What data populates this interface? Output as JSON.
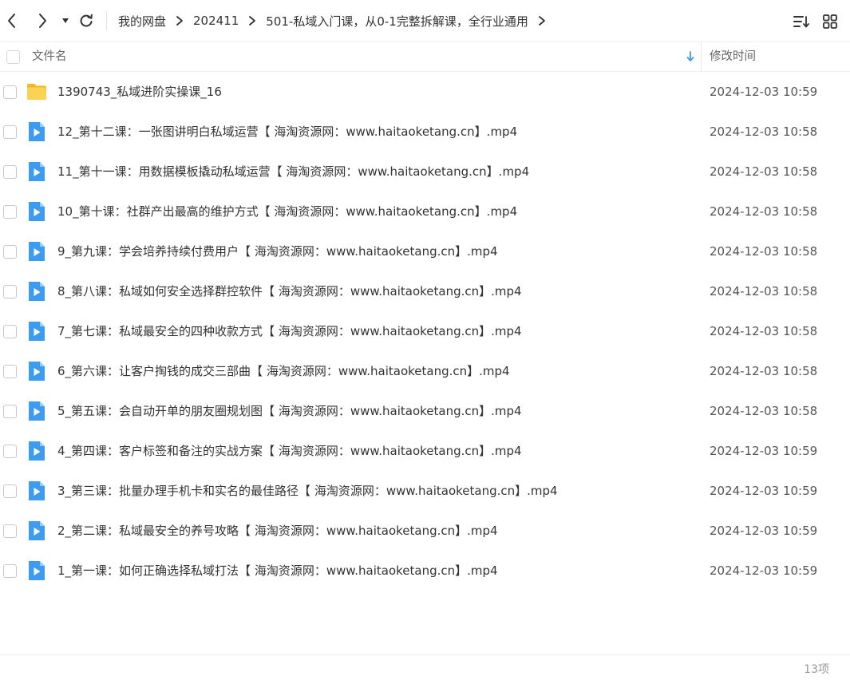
{
  "breadcrumb": [
    "我的网盘",
    "202411",
    "501-私域入门课，从0-1完整拆解课，全行业通用"
  ],
  "header": {
    "col_name": "文件名",
    "col_time": "修改时间"
  },
  "colors": {
    "folder": "#F7C843",
    "video": "#3D9BF0",
    "text": "#333333",
    "muted": "#999999"
  },
  "files": [
    {
      "name": "1390743_私域进阶实操课_16",
      "time": "2024-12-03 10:59",
      "type": "folder"
    },
    {
      "name": "12_第十二课：一张图讲明白私域运营【 海淘资源网：www.haitaoketang.cn】.mp4",
      "time": "2024-12-03 10:58",
      "type": "video"
    },
    {
      "name": "11_第十一课：用数据模板撬动私域运营【 海淘资源网：www.haitaoketang.cn】.mp4",
      "time": "2024-12-03 10:58",
      "type": "video"
    },
    {
      "name": "10_第十课：社群产出最高的维护方式【 海淘资源网：www.haitaoketang.cn】.mp4",
      "time": "2024-12-03 10:58",
      "type": "video"
    },
    {
      "name": "9_第九课：学会培养持续付费用户【 海淘资源网：www.haitaoketang.cn】.mp4",
      "time": "2024-12-03 10:58",
      "type": "video"
    },
    {
      "name": "8_第八课：私域如何安全选择群控软件【 海淘资源网：www.haitaoketang.cn】.mp4",
      "time": "2024-12-03 10:58",
      "type": "video"
    },
    {
      "name": "7_第七课：私域最安全的四种收款方式【 海淘资源网：www.haitaoketang.cn】.mp4",
      "time": "2024-12-03 10:58",
      "type": "video"
    },
    {
      "name": "6_第六课：让客户掏钱的成交三部曲【 海淘资源网：www.haitaoketang.cn】.mp4",
      "time": "2024-12-03 10:58",
      "type": "video"
    },
    {
      "name": "5_第五课：会自动开单的朋友圈规划图【 海淘资源网：www.haitaoketang.cn】.mp4",
      "time": "2024-12-03 10:58",
      "type": "video"
    },
    {
      "name": "4_第四课：客户标签和备注的实战方案【 海淘资源网：www.haitaoketang.cn】.mp4",
      "time": "2024-12-03 10:59",
      "type": "video"
    },
    {
      "name": "3_第三课：批量办理手机卡和实名的最佳路径【 海淘资源网：www.haitaoketang.cn】.mp4",
      "time": "2024-12-03 10:59",
      "type": "video"
    },
    {
      "name": "2_第二课：私域最安全的养号攻略【 海淘资源网：www.haitaoketang.cn】.mp4",
      "time": "2024-12-03 10:59",
      "type": "video"
    },
    {
      "name": "1_第一课：如何正确选择私域打法【 海淘资源网：www.haitaoketang.cn】.mp4",
      "time": "2024-12-03 10:59",
      "type": "video"
    }
  ],
  "footer": {
    "count": "13项"
  }
}
